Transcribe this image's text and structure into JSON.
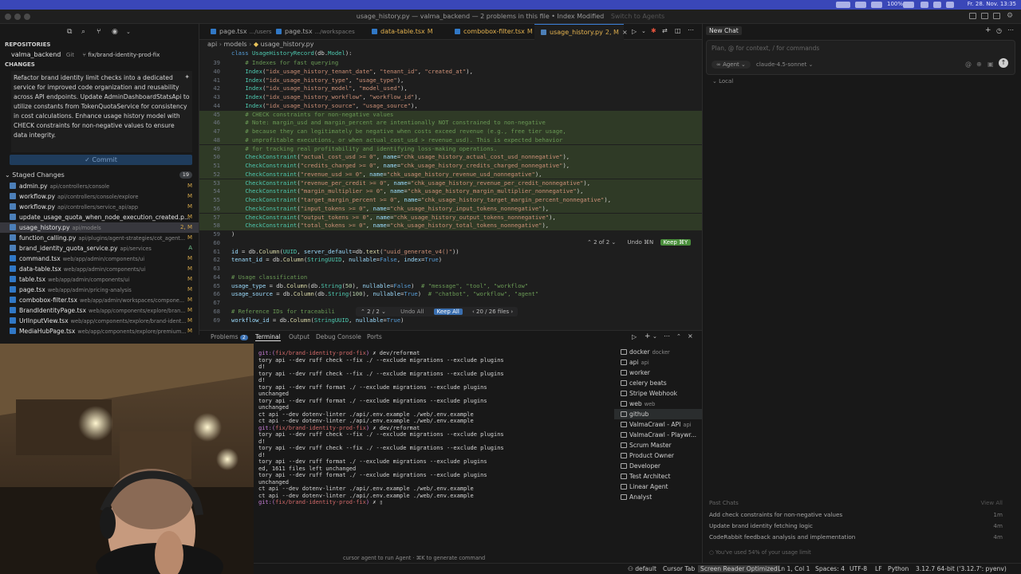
{
  "menubar": {
    "clock": "Fr. 28. Nov. 13:35",
    "battery": "100%"
  },
  "window": {
    "title": "usage_history.py — valma_backend — 2 problems in this file • Index Modified",
    "switch_agents": "Switch to Agents"
  },
  "sidebar": {
    "repositories_label": "REPOSITORIES",
    "repo_name": "valma_backend",
    "repo_vcs": "Git",
    "repo_branch": "fix/brand-identity-prod-fix",
    "changes_label": "CHANGES",
    "commit_message": "Refactor brand identity limit checks into a dedicated service for improved code organization and reusability across API endpoints. Update AdminDashboardStatsApi to utilize constants from TokenQuotaService for consistency in cost calculations. Enhance usage history model with CHECK constraints for non-negative values to ensure data integrity.",
    "commit_button": "Commit",
    "staged_label": "Staged Changes",
    "staged_count": "19",
    "files": [
      {
        "name": "admin.py",
        "path": "api/controllers/console",
        "status": "M",
        "type": "py"
      },
      {
        "name": "workflow.py",
        "path": "api/controllers/console/explore",
        "status": "M",
        "type": "py"
      },
      {
        "name": "workflow.py",
        "path": "api/controllers/service_api/app",
        "status": "M",
        "type": "py"
      },
      {
        "name": "update_usage_quota_when_node_execution_created.p...",
        "path": "",
        "status": "M",
        "type": "py"
      },
      {
        "name": "usage_history.py",
        "path": "api/models",
        "status": "2, M",
        "type": "py"
      },
      {
        "name": "function_calling.py",
        "path": "api/plugins/agent-strategies/cot_agent...",
        "status": "M",
        "type": "py"
      },
      {
        "name": "brand_identity_quota_service.py",
        "path": "api/services",
        "status": "A",
        "type": "py"
      },
      {
        "name": "command.tsx",
        "path": "web/app/admin/components/ui",
        "status": "M",
        "type": "ts"
      },
      {
        "name": "data-table.tsx",
        "path": "web/app/admin/components/ui",
        "status": "M",
        "type": "ts"
      },
      {
        "name": "table.tsx",
        "path": "web/app/admin/components/ui",
        "status": "M",
        "type": "ts"
      },
      {
        "name": "page.tsx",
        "path": "web/app/admin/pricing-analysis",
        "status": "M",
        "type": "ts"
      },
      {
        "name": "combobox-filter.tsx",
        "path": "web/app/admin/workspaces/compone...",
        "status": "M",
        "type": "ts"
      },
      {
        "name": "BrandIdentityPage.tsx",
        "path": "web/app/components/explore/bran...",
        "status": "M",
        "type": "ts"
      },
      {
        "name": "UrlInputView.tsx",
        "path": "web/app/components/explore/brand-ident...",
        "status": "M",
        "type": "ts"
      },
      {
        "name": "MediaHubPage.tsx",
        "path": "web/app/components/explore/premium...",
        "status": "M",
        "type": "ts"
      }
    ]
  },
  "editor": {
    "tabs": [
      {
        "label": "page.tsx",
        "sub": ".../users",
        "mod": ""
      },
      {
        "label": "page.tsx",
        "sub": ".../workspaces",
        "mod": ""
      },
      {
        "label": "data-table.tsx",
        "sub": "",
        "mod": "M"
      },
      {
        "label": "combobox-filter.tsx",
        "sub": "",
        "mod": "M"
      },
      {
        "label": "usage_history.py",
        "sub": "",
        "mod": "2, M"
      }
    ],
    "breadcrumb": [
      "api",
      "models",
      "usage_history.py"
    ],
    "class_line": "class UsageHistoryRecord(db.Model):",
    "hunk1": {
      "count": "2 of 2",
      "undo": "Undo ⌘N",
      "keep": "Keep ⌘Y"
    },
    "hunk2": {
      "count": "2 / 2",
      "undo": "Undo All",
      "keep": "Keep All",
      "files": "20 / 26 files"
    }
  },
  "panel": {
    "tabs": [
      "Problems",
      "Terminal",
      "Output",
      "Debug Console",
      "Ports"
    ],
    "problems_count": "2",
    "hint": "cursor agent to run Agent · ⌘K to generate command",
    "terminals": [
      {
        "name": "docker",
        "tag": "docker"
      },
      {
        "name": "api",
        "tag": "api"
      },
      {
        "name": "worker",
        "tag": ""
      },
      {
        "name": "celery beats",
        "tag": ""
      },
      {
        "name": "Stripe Webhook",
        "tag": ""
      },
      {
        "name": "web",
        "tag": "web"
      },
      {
        "name": "github",
        "tag": ""
      },
      {
        "name": "ValmaCrawl - API",
        "tag": "api"
      },
      {
        "name": "ValmaCrawl - Playwr...",
        "tag": ""
      },
      {
        "name": "Scrum Master",
        "tag": ""
      },
      {
        "name": "Product Owner",
        "tag": ""
      },
      {
        "name": "Developer",
        "tag": ""
      },
      {
        "name": "Test Architect",
        "tag": ""
      },
      {
        "name": "Linear Agent",
        "tag": ""
      },
      {
        "name": "Analyst",
        "tag": ""
      }
    ]
  },
  "chat": {
    "new_chat": "New Chat",
    "placeholder": "Plan, @ for context, / for commands",
    "mode": "Agent",
    "model": "claude-4.5-sonnet",
    "local": "Local",
    "past_label": "Past Chats",
    "view_all": "View All",
    "past": [
      {
        "title": "Add check constraints for non-negative values",
        "time": "1m"
      },
      {
        "title": "Update brand identity fetching logic",
        "time": "4m"
      },
      {
        "title": "CodeRabbit feedback analysis and implementation",
        "time": "4m"
      }
    ],
    "usage_note": "You've used 54% of your usage limit"
  },
  "statusbar": {
    "profile": "default",
    "cursor_tab": "Cursor Tab",
    "screen_reader": "Screen Reader Optimized",
    "position": "Ln 1, Col 1",
    "spaces": "Spaces: 4",
    "encoding": "UTF-8",
    "eol": "LF",
    "language": "Python",
    "interpreter": "3.12.7 64-bit ('3.12.7': pyenv)"
  }
}
